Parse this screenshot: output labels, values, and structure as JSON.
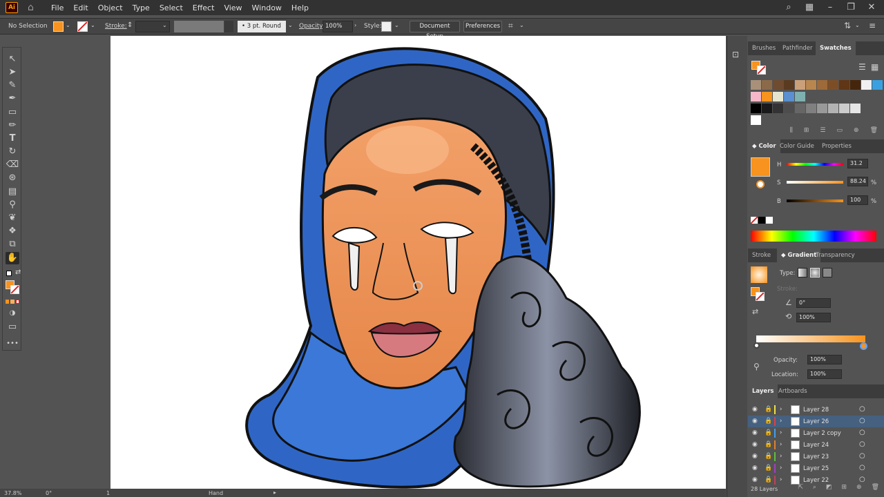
{
  "menu": {
    "items": [
      "File",
      "Edit",
      "Object",
      "Type",
      "Select",
      "Effect",
      "View",
      "Window",
      "Help"
    ]
  },
  "control": {
    "selection": "No Selection",
    "stroke_label": "Stroke:",
    "brush": "3 pt. Round",
    "opacity_label": "Opacity:",
    "opacity_value": "100%",
    "style_label": "Style:",
    "doc_setup": "Document Setup",
    "preferences": "Preferences"
  },
  "status": {
    "zoom": "37.8%",
    "rotation": "0°",
    "artboard": "1",
    "tool": "Hand"
  },
  "swatches_panel": {
    "tabs": [
      "Brushes",
      "Pathfinder",
      "Swatches"
    ],
    "active": "Swatches",
    "colors_row1": [
      "#a89178",
      "#8b6a4a",
      "#6f4b30",
      "#5a3b20",
      "#caa07a",
      "#b8864f",
      "#9d6a3a",
      "#7d4e26",
      "#5f3616",
      "#45260c",
      "#f0f0f0",
      "#3aa0e0"
    ],
    "colors_row2": [
      "#f5b8c8",
      "#f7941d",
      "#e6e6d0",
      "#5a8fd0",
      "#7fb0b0"
    ],
    "colors_row3": [
      "#000000",
      "#1a1a1a",
      "#333333",
      "#4d4d4d",
      "#666666",
      "#808080",
      "#999999",
      "#b3b3b3",
      "#cccccc",
      "#e6e6e6"
    ],
    "colors_row4": [
      "#ffffff"
    ]
  },
  "color_panel": {
    "tabs": [
      "Color",
      "Color Guide",
      "Properties"
    ],
    "active": "Color",
    "fill": "#f7931e",
    "h_label": "H",
    "h_value": "31.2",
    "s_label": "S",
    "s_value": "88.24",
    "s_unit": "%",
    "b_label": "B",
    "b_value": "100",
    "b_unit": "%"
  },
  "gradient_panel": {
    "tabs": [
      "Stroke",
      "Gradient",
      "Transparency"
    ],
    "active": "Gradient",
    "type_label": "Type:",
    "stroke_label": "Stroke:",
    "angle": "0°",
    "aspect": "100%",
    "opacity_label": "Opacity:",
    "opacity_value": "100%",
    "location_label": "Location:",
    "location_value": "100%"
  },
  "layers_panel": {
    "tabs": [
      "Layers",
      "Artboards"
    ],
    "active": "Layers",
    "count": "28 Layers",
    "layers": [
      {
        "name": "Layer 28",
        "color": "#f0e040",
        "selected": false
      },
      {
        "name": "Layer 26",
        "color": "#e04040",
        "selected": true
      },
      {
        "name": "Layer 2 copy",
        "color": "#40a0f0",
        "selected": false
      },
      {
        "name": "Layer 24",
        "color": "#e08030",
        "selected": false
      },
      {
        "name": "Layer 23",
        "color": "#60c040",
        "selected": false
      },
      {
        "name": "Layer 25",
        "color": "#a040c0",
        "selected": false
      },
      {
        "name": "Layer 22",
        "color": "#c04060",
        "selected": false
      }
    ]
  }
}
